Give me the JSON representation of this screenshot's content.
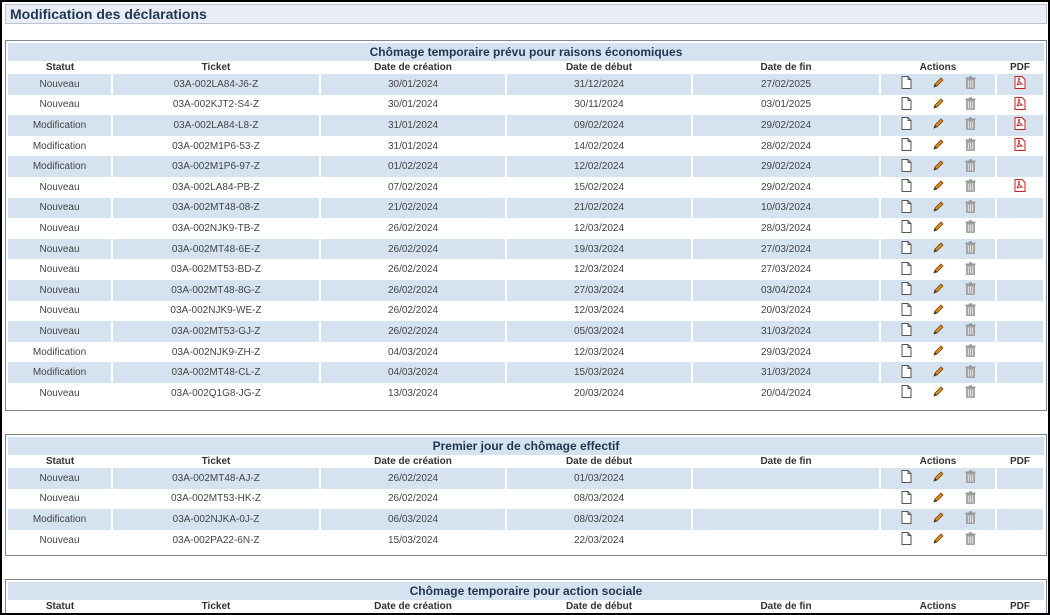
{
  "page": {
    "title": "Modification des déclarations"
  },
  "columns": {
    "statut": "Statut",
    "ticket": "Ticket",
    "date_creation": "Date de création",
    "date_debut": "Date de début",
    "date_fin": "Date de fin",
    "actions": "Actions",
    "pdf": "PDF"
  },
  "sections": [
    {
      "title": "Chômage temporaire prévu pour raisons économiques",
      "rows": [
        {
          "statut": "Nouveau",
          "ticket": "03A-002LA84-J6-Z",
          "creation": "30/01/2024",
          "debut": "31/12/2024",
          "fin": "27/02/2025",
          "pdf": true
        },
        {
          "statut": "Nouveau",
          "ticket": "03A-002KJT2-S4-Z",
          "creation": "30/01/2024",
          "debut": "30/11/2024",
          "fin": "03/01/2025",
          "pdf": true
        },
        {
          "statut": "Modification",
          "ticket": "03A-002LA84-L8-Z",
          "creation": "31/01/2024",
          "debut": "09/02/2024",
          "fin": "29/02/2024",
          "pdf": true
        },
        {
          "statut": "Modification",
          "ticket": "03A-002M1P6-53-Z",
          "creation": "31/01/2024",
          "debut": "14/02/2024",
          "fin": "28/02/2024",
          "pdf": true
        },
        {
          "statut": "Modification",
          "ticket": "03A-002M1P6-97-Z",
          "creation": "01/02/2024",
          "debut": "12/02/2024",
          "fin": "29/02/2024",
          "pdf": false
        },
        {
          "statut": "Nouveau",
          "ticket": "03A-002LA84-PB-Z",
          "creation": "07/02/2024",
          "debut": "15/02/2024",
          "fin": "29/02/2024",
          "pdf": true
        },
        {
          "statut": "Nouveau",
          "ticket": "03A-002MT48-08-Z",
          "creation": "21/02/2024",
          "debut": "21/02/2024",
          "fin": "10/03/2024",
          "pdf": false
        },
        {
          "statut": "Nouveau",
          "ticket": "03A-002NJK9-TB-Z",
          "creation": "26/02/2024",
          "debut": "12/03/2024",
          "fin": "28/03/2024",
          "pdf": false
        },
        {
          "statut": "Nouveau",
          "ticket": "03A-002MT48-6E-Z",
          "creation": "26/02/2024",
          "debut": "19/03/2024",
          "fin": "27/03/2024",
          "pdf": false
        },
        {
          "statut": "Nouveau",
          "ticket": "03A-002MT53-BD-Z",
          "creation": "26/02/2024",
          "debut": "12/03/2024",
          "fin": "27/03/2024",
          "pdf": false
        },
        {
          "statut": "Nouveau",
          "ticket": "03A-002MT48-8G-Z",
          "creation": "26/02/2024",
          "debut": "27/03/2024",
          "fin": "03/04/2024",
          "pdf": false
        },
        {
          "statut": "Nouveau",
          "ticket": "03A-002NJK9-WE-Z",
          "creation": "26/02/2024",
          "debut": "12/03/2024",
          "fin": "20/03/2024",
          "pdf": false
        },
        {
          "statut": "Nouveau",
          "ticket": "03A-002MT53-GJ-Z",
          "creation": "26/02/2024",
          "debut": "05/03/2024",
          "fin": "31/03/2024",
          "pdf": false
        },
        {
          "statut": "Modification",
          "ticket": "03A-002NJK9-ZH-Z",
          "creation": "04/03/2024",
          "debut": "12/03/2024",
          "fin": "29/03/2024",
          "pdf": false
        },
        {
          "statut": "Modification",
          "ticket": "03A-002MT48-CL-Z",
          "creation": "04/03/2024",
          "debut": "15/03/2024",
          "fin": "31/03/2024",
          "pdf": false
        },
        {
          "statut": "Nouveau",
          "ticket": "03A-002Q1G8-JG-Z",
          "creation": "13/03/2024",
          "debut": "20/03/2024",
          "fin": "20/04/2024",
          "pdf": false
        }
      ]
    },
    {
      "title": "Premier jour de chômage effectif",
      "rows": [
        {
          "statut": "Nouveau",
          "ticket": "03A-002MT48-AJ-Z",
          "creation": "26/02/2024",
          "debut": "01/03/2024",
          "fin": "",
          "pdf": false
        },
        {
          "statut": "Nouveau",
          "ticket": "03A-002MT53-HK-Z",
          "creation": "26/02/2024",
          "debut": "08/03/2024",
          "fin": "",
          "pdf": false
        },
        {
          "statut": "Modification",
          "ticket": "03A-002NJKA-0J-Z",
          "creation": "06/03/2024",
          "debut": "08/03/2024",
          "fin": "",
          "pdf": false
        },
        {
          "statut": "Nouveau",
          "ticket": "03A-002PA22-6N-Z",
          "creation": "15/03/2024",
          "debut": "22/03/2024",
          "fin": "",
          "pdf": false
        }
      ]
    },
    {
      "title": "Chômage temporaire pour action sociale",
      "rows": []
    }
  ],
  "icons": {
    "view": "document-icon",
    "edit": "pencil-icon",
    "delete": "trash-icon",
    "pdf": "pdf-icon"
  },
  "colors": {
    "row_alt": "#d5e3f1",
    "title_text": "#1f3650",
    "pdf_red": "#d3191c"
  }
}
